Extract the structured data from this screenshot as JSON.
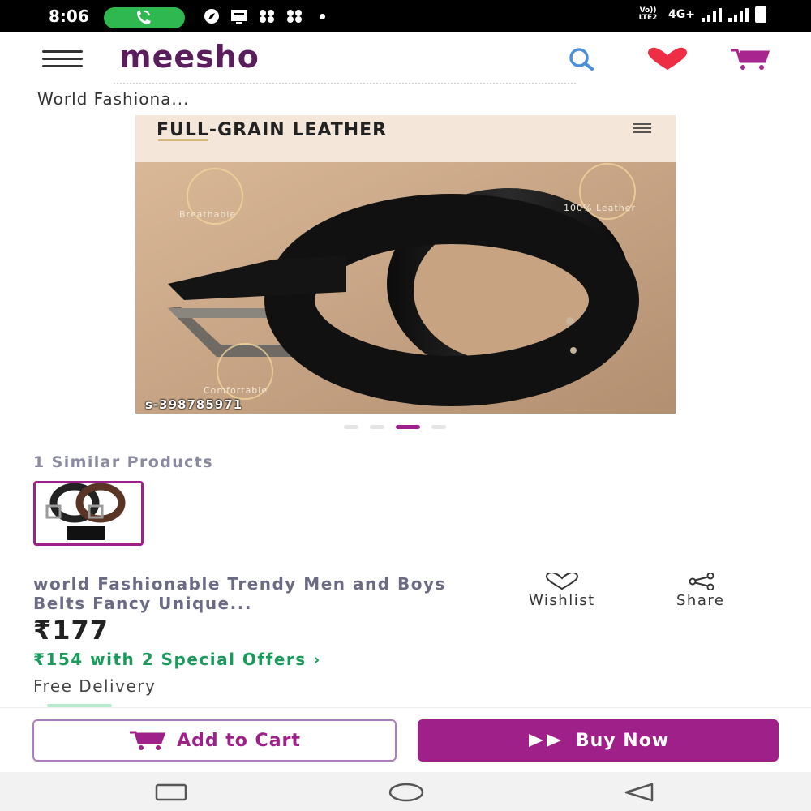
{
  "status_bar": {
    "time": "8:06",
    "network_label": "Vo)) LTE2",
    "network_type": "4G+"
  },
  "header": {
    "brand": "meesho",
    "icons": [
      "menu-icon",
      "search-icon",
      "heart-icon",
      "cart-icon"
    ],
    "brand_color": "#5a1e5c",
    "accent_color": "#9f2089"
  },
  "breadcrumb": {
    "text": "World Fashiona..."
  },
  "product_image": {
    "banner_title": "FULL-GRAIN LEATHER",
    "features": [
      "Breathable",
      "100% Leather",
      "Comfortable"
    ],
    "sku": "s-398785971",
    "carousel": {
      "count": 4,
      "active_index": 3
    }
  },
  "similar": {
    "title": "1 Similar Products"
  },
  "product": {
    "title": "world Fashionable Trendy Men and Boys Belts Fancy Unique...",
    "price": "₹177",
    "offer": "₹154 with 2 Special Offers ›",
    "delivery": "Free Delivery",
    "offer_color": "#1a9b5c"
  },
  "actions": {
    "wishlist": "Wishlist",
    "share": "Share"
  },
  "cta": {
    "add_to_cart": "Add to Cart",
    "buy_now": "Buy Now"
  }
}
